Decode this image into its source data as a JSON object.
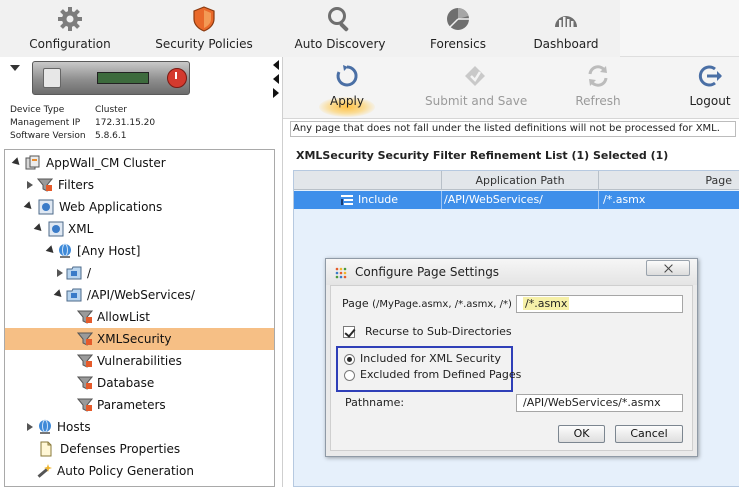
{
  "topnav": {
    "items": [
      {
        "label": "Configuration",
        "icon": "gear-icon"
      },
      {
        "label": "Security Policies",
        "icon": "shield-icon"
      },
      {
        "label": "Auto Discovery",
        "icon": "magnifier-icon"
      },
      {
        "label": "Forensics",
        "icon": "pie-chart-icon"
      },
      {
        "label": "Dashboard",
        "icon": "dashboard-gauge-icon"
      }
    ]
  },
  "device": {
    "info": [
      {
        "key": "Device Type",
        "value": "Cluster"
      },
      {
        "key": "Management IP",
        "value": "172.31.15.20"
      },
      {
        "key": "Software Version",
        "value": "5.8.6.1"
      }
    ]
  },
  "tree": {
    "items": [
      {
        "label": "AppWall_CM Cluster"
      },
      {
        "label": "Filters"
      },
      {
        "label": "Web Applications"
      },
      {
        "label": "XML"
      },
      {
        "label": "[Any Host]"
      },
      {
        "label": "/"
      },
      {
        "label": "/API/WebServices/"
      },
      {
        "label": "AllowList"
      },
      {
        "label": "XMLSecurity"
      },
      {
        "label": "Vulnerabilities"
      },
      {
        "label": "Database"
      },
      {
        "label": "Parameters"
      },
      {
        "label": "Hosts"
      },
      {
        "label": "Defenses Properties"
      },
      {
        "label": "Auto Policy Generation"
      }
    ]
  },
  "toolbar": {
    "apply": "Apply",
    "submit_and_save": "Submit and Save",
    "refresh": "Refresh",
    "logout": "Logout"
  },
  "main": {
    "notice": "Any page that does not fall under the listed definitions will not be processed for XML.",
    "list_title": "XMLSecurity Security Filter Refinement List (1) Selected (1)",
    "columns": [
      "Application Path",
      "Page"
    ],
    "rows": [
      {
        "mode": "Include",
        "application_path": "/API/WebServices/",
        "page": "/*.asmx"
      }
    ]
  },
  "dialog": {
    "title": "Configure Page Settings",
    "page_label": "Page",
    "page_hint": "(/MyPage.asmx, /*.asmx, /*)",
    "page_value": "/*.asmx",
    "recurse_label": "Recurse to Sub-Directories",
    "recurse_checked": true,
    "radio_included": "Included for XML Security",
    "radio_excluded": "Excluded from Defined Pages",
    "selected_option": "included",
    "pathname_label": "Pathname:",
    "pathname_value": "/API/WebServices/*.asmx",
    "ok": "OK",
    "cancel": "Cancel"
  },
  "colors": {
    "selection_highlight": "#f6bf85",
    "grid_row_selected": "#3f8fea",
    "radio_group_outline": "#2f3fb8",
    "shield_orange": "#e9692a"
  }
}
